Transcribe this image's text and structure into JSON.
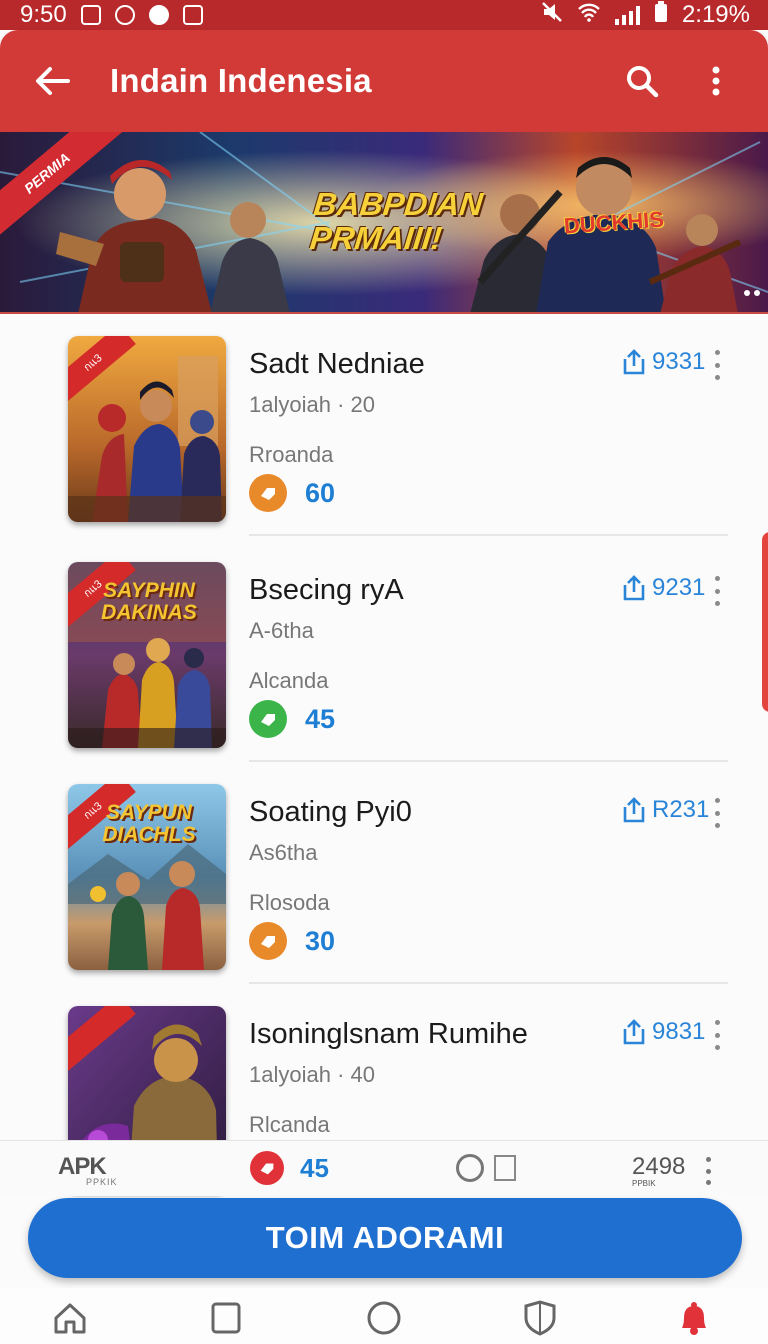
{
  "status_bar": {
    "time": "9:50",
    "battery": "2:19%"
  },
  "app_bar": {
    "title": "Indain Indenesia",
    "back_icon": "arrow-left-icon",
    "search_icon": "search-icon",
    "more_icon": "more-vert-icon"
  },
  "banner": {
    "ribbon": "PERMIA",
    "headline": "BABPDIAN PRMAIII!",
    "badge": "DUCKHIS"
  },
  "games": [
    {
      "title": "Sadt Nedniae",
      "subtitle": "1alyoiah · 20",
      "category": "Rroanda",
      "score": "60",
      "score_color": "#e8892a",
      "likes": "9331",
      "thumb_ribbon": "กแ3",
      "thumb_logo": ""
    },
    {
      "title": "Bsecing ryA",
      "subtitle": "A-6tha",
      "category": "Alcanda",
      "score": "45",
      "score_color": "#3bb44a",
      "likes": "9231",
      "thumb_ribbon": "กแ3",
      "thumb_logo": "SAYPHIN DAKINAS"
    },
    {
      "title": "Soating Pyi0",
      "subtitle": "As6tha",
      "category": "Rlosoda",
      "score": "30",
      "score_color": "#e8892a",
      "likes": "R231",
      "thumb_ribbon": "กแ3",
      "thumb_logo": "SAYPUN DIACHLS"
    },
    {
      "title": "Isoninglsnam Rumihe",
      "subtitle": "1alyoiah · 40",
      "category": "Rlcanda",
      "score": "",
      "score_color": "#e8892a",
      "likes": "9831",
      "thumb_ribbon": "",
      "thumb_logo": ""
    }
  ],
  "info_bar": {
    "logo": "APK",
    "logo_sub": "PPKIK",
    "score": "45",
    "count": "2498",
    "count_sub": "PPBIK"
  },
  "cta": {
    "label": "TOIM ADORAMI"
  },
  "nav": {
    "home_icon": "home-icon",
    "recents_icon": "square-icon",
    "circle_icon": "circle-icon",
    "shield_icon": "shield-icon",
    "alert_icon": "bell-icon"
  },
  "colors": {
    "app_bar": "#d23a37",
    "status_bar": "#b8292b",
    "accent_blue": "#1f6fd1",
    "score_blue": "#1e7ed3"
  }
}
